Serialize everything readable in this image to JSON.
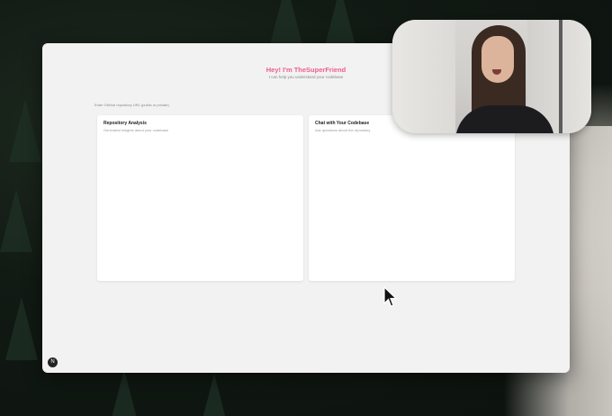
{
  "hero": {
    "title": "Hey! I'm TheSuperFriend",
    "subtitle": "I can help you understand your codebase"
  },
  "repo_input": {
    "label": "Enter GitHub repository URL (public or private)"
  },
  "panels": [
    {
      "title": "Repository Analysis",
      "subtitle": "Generated insights about your codebase"
    },
    {
      "title": "Chat with Your Codebase",
      "subtitle": "Ask questions about the repository"
    }
  ],
  "help_button": {
    "label": "N",
    "icon": "help-icon"
  },
  "colors": {
    "accent": "#ee5f8b",
    "window_bg": "#f2f2f2",
    "panel_bg": "#ffffff"
  }
}
